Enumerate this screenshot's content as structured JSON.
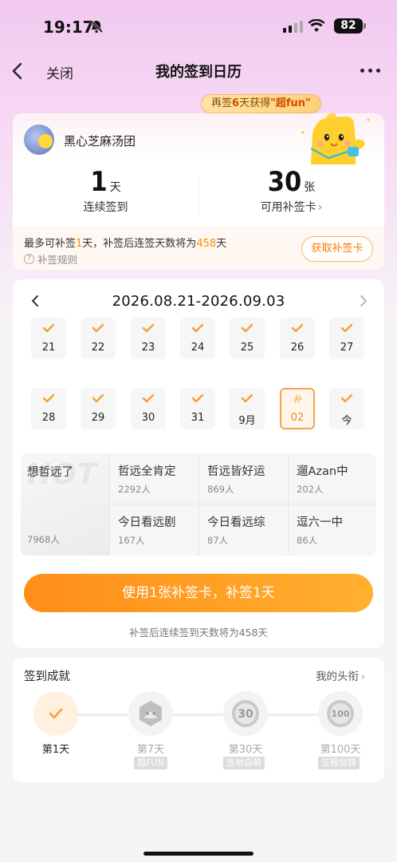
{
  "status_bar": {
    "time": "19:17",
    "battery": "82"
  },
  "nav": {
    "close_label": "关闭",
    "title": "我的签到日历"
  },
  "bubble": {
    "prefix": "再签",
    "days": "6",
    "middle": "天获得",
    "reward": "\"超fun\""
  },
  "profile": {
    "name": "黑心芝麻汤团"
  },
  "stats": {
    "streak_value": "1",
    "streak_unit": "天",
    "streak_label": "连续签到",
    "cards_value": "30",
    "cards_unit": "张",
    "cards_label": "可用补签卡"
  },
  "makeup_info": {
    "line_a": "最多可补签",
    "max_days": "1",
    "line_b": "天，补签后连签天数将为",
    "total": "458",
    "line_c": "天",
    "rule_label": "补签规则",
    "get_card_label": "获取补签卡"
  },
  "calendar": {
    "range": "2026.08.21-2026.09.03",
    "days": [
      {
        "label": "21",
        "checked": true
      },
      {
        "label": "22",
        "checked": true
      },
      {
        "label": "23",
        "checked": true
      },
      {
        "label": "24",
        "checked": true
      },
      {
        "label": "25",
        "checked": true
      },
      {
        "label": "26",
        "checked": true
      },
      {
        "label": "27",
        "checked": true
      },
      {
        "label": "28",
        "checked": true
      },
      {
        "label": "29",
        "checked": true
      },
      {
        "label": "30",
        "checked": true
      },
      {
        "label": "31",
        "checked": true
      },
      {
        "label": "9月",
        "checked": true
      },
      {
        "label": "02",
        "checked": false,
        "makeup_tag": "补"
      },
      {
        "label": "今",
        "checked": true
      }
    ]
  },
  "hot_topics": {
    "watermark": "HOT",
    "featured": {
      "title": "想哲远了",
      "count": "7968人"
    },
    "items": [
      {
        "title": "哲远全肯定",
        "count": "2292人"
      },
      {
        "title": "哲远皆好运",
        "count": "869人"
      },
      {
        "title": "遛Azan中",
        "count": "202人"
      },
      {
        "title": "今日看远剧",
        "count": "167人"
      },
      {
        "title": "今日看远综",
        "count": "87人"
      },
      {
        "title": "逗六一中",
        "count": "86人"
      }
    ]
  },
  "use_button": {
    "label": "使用1张补签卡，补签1天",
    "note": "补签后连续签到天数将为458天"
  },
  "achievements": {
    "title": "签到成就",
    "link": "我的头衔",
    "items": [
      {
        "label": "第1天",
        "tag": "",
        "done": true
      },
      {
        "label": "第7天",
        "tag": "超FUN",
        "done": false
      },
      {
        "label": "第30天",
        "tag": "签地自萌",
        "done": false
      },
      {
        "label": "第100天",
        "tag": "签程似锦",
        "done": false
      }
    ]
  },
  "colors": {
    "accent": "#ff8d1a",
    "highlight": "#ff8a00",
    "check": "#f5a033"
  }
}
